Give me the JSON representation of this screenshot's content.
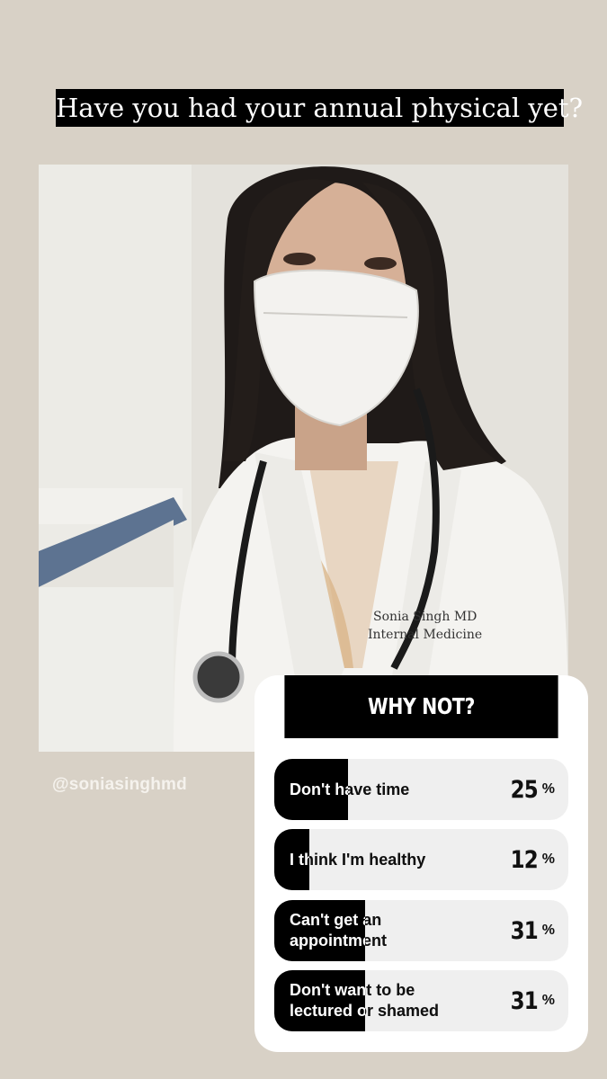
{
  "story": {
    "question": "Have you had your annual physical yet?",
    "mention": "@soniasinghmd",
    "photo": {
      "coat_name": "Sonia Singh MD",
      "coat_title": "Internal Medicine"
    }
  },
  "poll": {
    "title": "WHY NOT?",
    "accent": "#000000",
    "track_color": "#efefef",
    "options": [
      {
        "label": "Don't have time",
        "percent": "25",
        "fill": 0.25
      },
      {
        "label": "I think I'm healthy",
        "percent": "12",
        "fill": 0.12
      },
      {
        "label": "Can't get an appointment",
        "percent": "31",
        "fill": 0.31
      },
      {
        "label": "Don't want to be lectured or shamed",
        "percent": "31",
        "fill": 0.31
      }
    ],
    "percent_symbol": "%"
  }
}
